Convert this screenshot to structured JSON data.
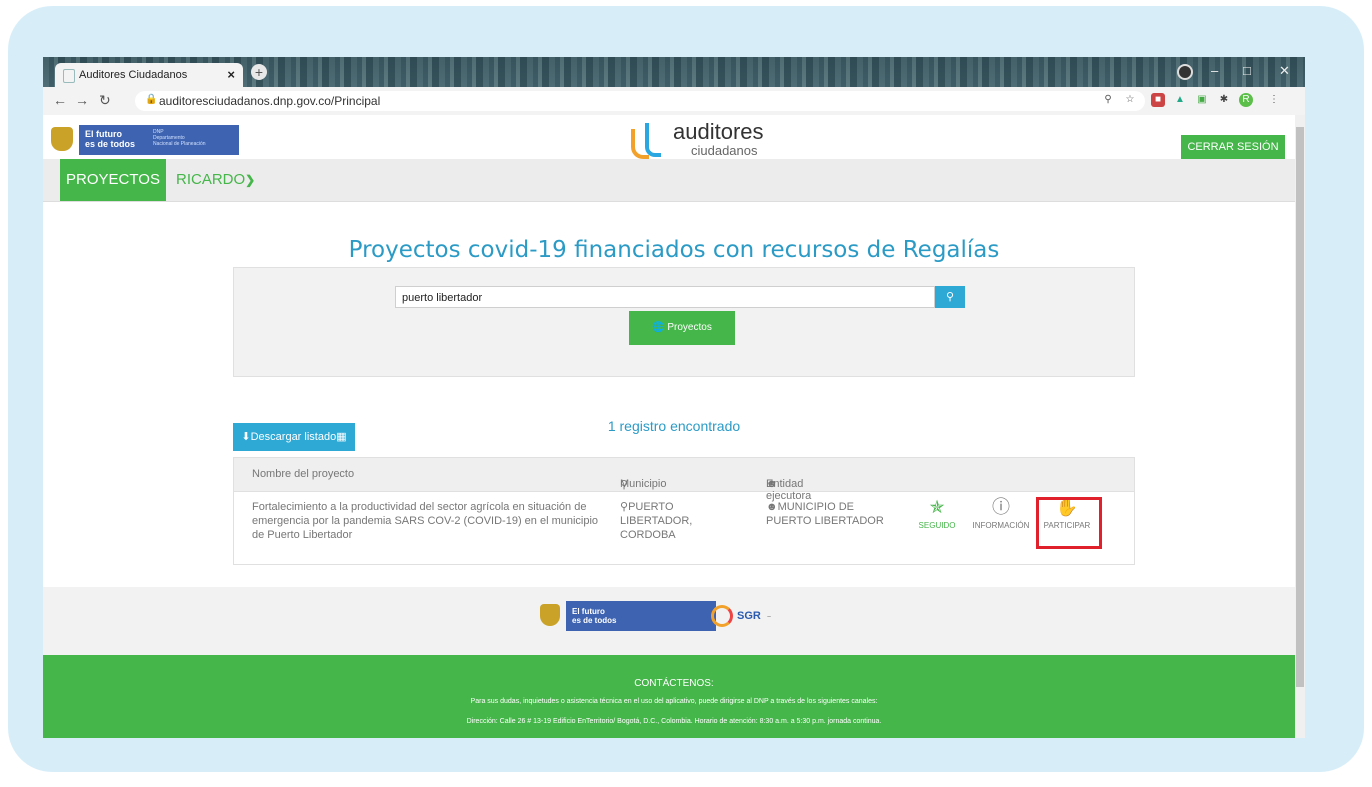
{
  "browser": {
    "tab_title": "Auditores Ciudadanos",
    "tab_close": "×",
    "new_tab": "+",
    "url": "auditoresciudadanos.dnp.gov.co/Principal"
  },
  "header": {
    "gov_logo_text": "El futuro\nes de todos",
    "gov_logo_sub": "DNP\nDepartamento\nNacional de Planeación",
    "brand_word": "auditores",
    "brand_sub": "ciudadanos",
    "logout": "CERRAR SESIÓN"
  },
  "navbar": {
    "projects": "PROYECTOS",
    "user": "RICARDO"
  },
  "main": {
    "title": "Proyectos covid-19 financiados con recursos de Regalías",
    "search_value": "puerto libertador",
    "projects_button": "Proyectos",
    "result_count": "1 registro encontrado",
    "download_button": "Descargar listado"
  },
  "table": {
    "headers": [
      "Nombre del proyecto",
      "Municipio",
      "Entidad ejecutora"
    ],
    "rows": [
      {
        "project": "Fortalecimiento a la productividad del sector agrícola en situación de emergencia por la pandemia SARS COV-2 (COVID-19) en el municipio de Puerto Libertador",
        "municipio": "PUERTO LIBERTADOR, CORDOBA",
        "entidad": "MUNICIPIO DE PUERTO LIBERTADOR",
        "actions": [
          "SEGUIDO",
          "INFORMACIÓN",
          "PARTICIPAR"
        ]
      }
    ]
  },
  "footer": {
    "logo_text": "El futuro\nes de todos",
    "sgr": "SGR",
    "contact_title": "CONTÁCTENOS:",
    "contact_line1": "Para sus dudas, inquietudes o asistencia técnica en el uso del aplicativo, puede dirigirse al DNP a través de los siguientes canales:",
    "contact_line2": "Dirección: Calle 26 # 13-19 Edificio EnTerritorio/ Bogotá, D.C., Colombia. Horario de atención: 8:30 a.m. a 5:30 p.m. jornada continua."
  },
  "colors": {
    "accent_green": "#45b649",
    "accent_blue": "#2ea8d5",
    "highlight_red": "#e0202a",
    "frame_bg": "#d7eef9"
  },
  "icons": [
    "globe-icon",
    "search-icon",
    "download-icon",
    "map-marker-icon",
    "user-icon",
    "pin-icon",
    "info-icon",
    "hand-icon",
    "chevron-down-icon",
    "lock-icon",
    "star-icon",
    "key-icon"
  ]
}
